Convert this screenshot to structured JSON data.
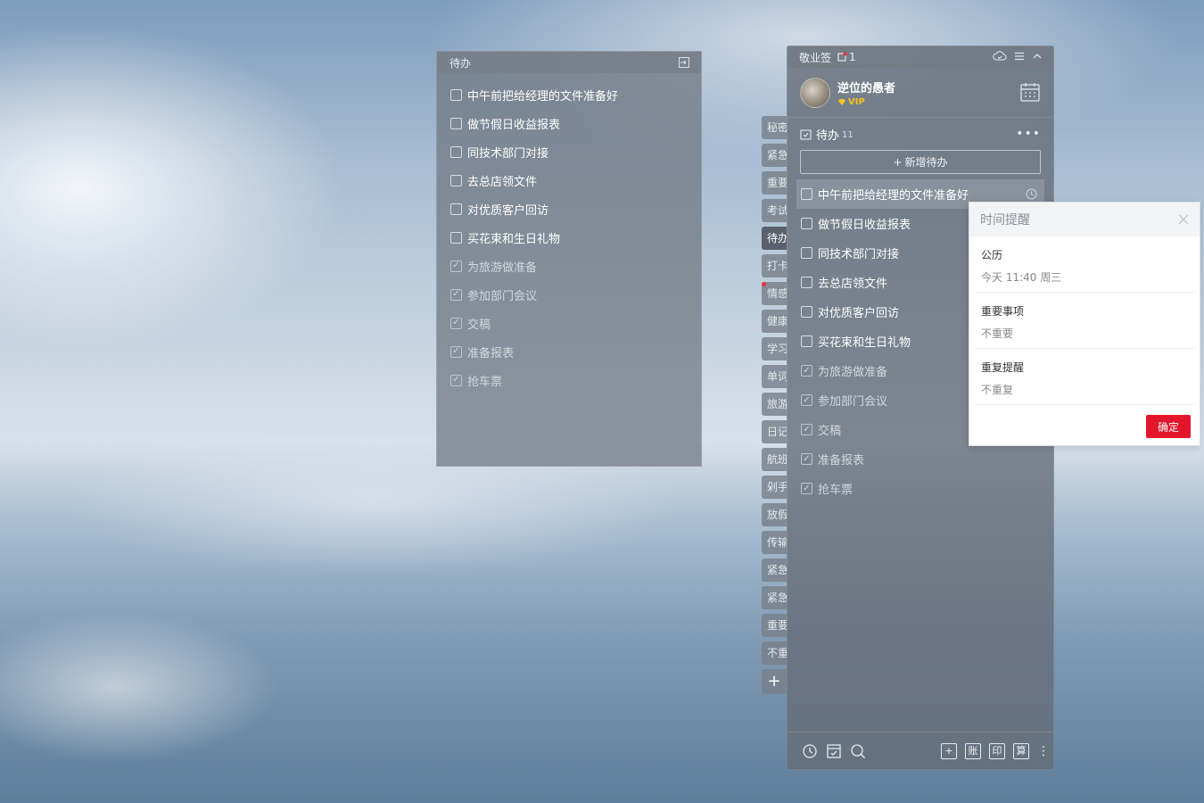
{
  "note_panel": {
    "title": "待办",
    "items": [
      {
        "label": "中午前把给经理的文件准备好",
        "done": false
      },
      {
        "label": "做节假日收益报表",
        "done": false
      },
      {
        "label": "同技术部门对接",
        "done": false
      },
      {
        "label": "去总店领文件",
        "done": false
      },
      {
        "label": "对优质客户回访",
        "done": false
      },
      {
        "label": "买花束和生日礼物",
        "done": false
      },
      {
        "label": "为旅游做准备",
        "done": true
      },
      {
        "label": "参加部门会议",
        "done": true
      },
      {
        "label": "交稿",
        "done": true
      },
      {
        "label": "准备报表",
        "done": true
      },
      {
        "label": "抢车票",
        "done": true
      }
    ]
  },
  "side_tabs": [
    "秘密",
    "紧急",
    "重要",
    "考试",
    "待办",
    "打卡",
    "情感",
    "健康",
    "学习",
    "单词",
    "旅游",
    "日记",
    "航班",
    "剁手",
    "放假",
    "传输",
    "紧急",
    "紧急",
    "重要",
    "不重"
  ],
  "side_tabs_active": "待办",
  "side_tabs_add": "+",
  "app": {
    "title": "敬业签",
    "notification_count": "1",
    "user": {
      "name": "逆位的愚者",
      "badge": "VIP"
    },
    "todo_section": {
      "title": "待办",
      "count": "11",
      "more": "•••"
    },
    "add_todo": {
      "plus": "+",
      "label": "新增待办"
    },
    "items": [
      {
        "label": "中午前把给经理的文件准备好",
        "done": false
      },
      {
        "label": "做节假日收益报表",
        "done": false
      },
      {
        "label": "同技术部门对接",
        "done": false
      },
      {
        "label": "去总店领文件",
        "done": false
      },
      {
        "label": "对优质客户回访",
        "done": false
      },
      {
        "label": "买花束和生日礼物",
        "done": false
      },
      {
        "label": "为旅游做准备",
        "done": true
      },
      {
        "label": "参加部门会议",
        "done": true
      },
      {
        "label": "交稿",
        "done": true
      },
      {
        "label": "准备报表",
        "done": true
      },
      {
        "label": "抢车票",
        "done": true
      }
    ],
    "footer": {
      "left_icons": [
        "clock-icon",
        "archive-icon",
        "search-icon"
      ],
      "add": "+",
      "ledger": "账",
      "print": "印",
      "calc": "算",
      "more": "⋮"
    }
  },
  "reminder": {
    "title": "时间提醒",
    "calendar_type": "公历",
    "datetime": "今天 11:40 周三",
    "importance_label": "重要事项",
    "importance_value": "不重要",
    "repeat_label": "重复提醒",
    "repeat_value": "不重复",
    "confirm": "确定"
  },
  "colors": {
    "accent_red": "#e3162b",
    "vip_gold": "#f5c518"
  }
}
